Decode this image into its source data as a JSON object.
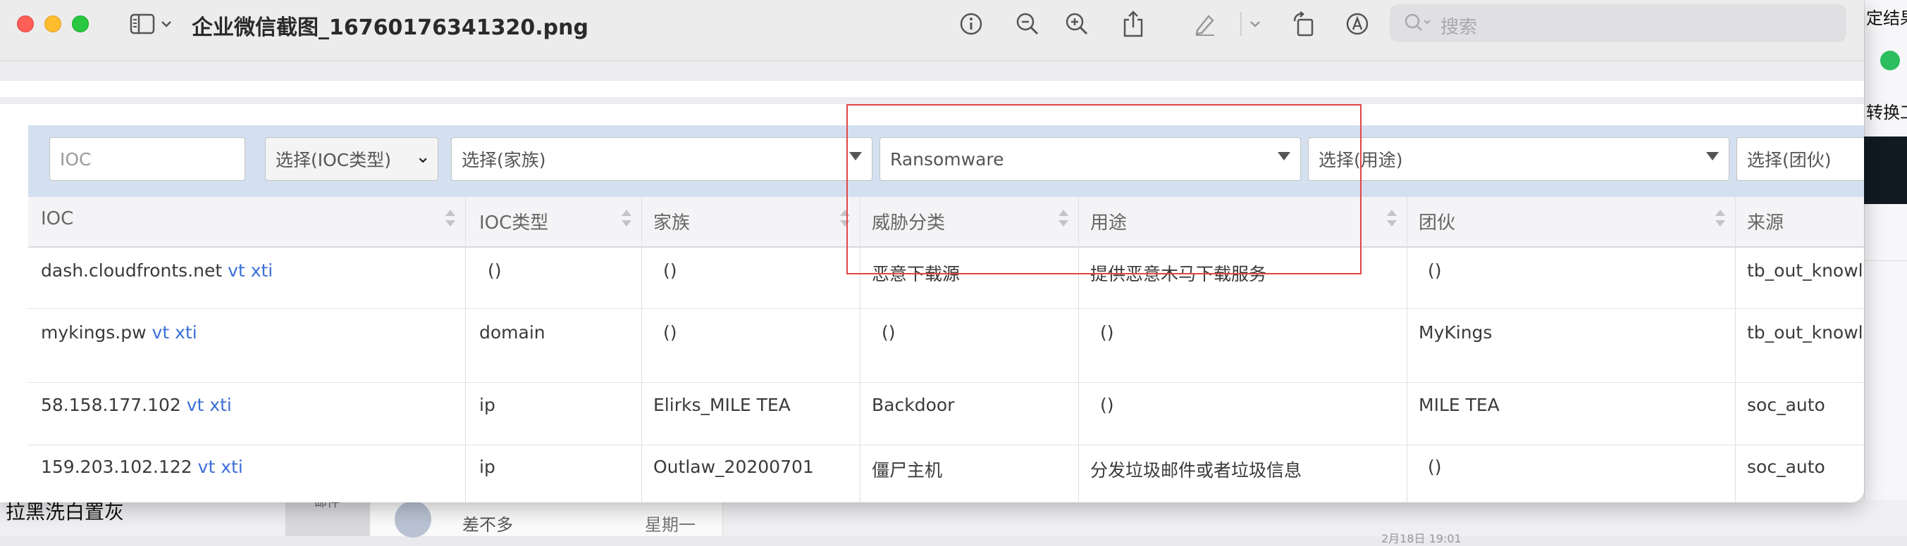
{
  "window": {
    "title": "企业微信截图_16760176341320.png",
    "search_placeholder": "搜索"
  },
  "toolbar_icons": [
    "sidebar-icon",
    "chevron-down-icon",
    "info-icon",
    "zoom-out-icon",
    "zoom-in-icon",
    "share-icon",
    "markup-pen-icon",
    "chevron-down-icon",
    "rotate-icon",
    "annotate-icon",
    "search-icon"
  ],
  "filters": {
    "ioc_placeholder": "IOC",
    "ioc_type": "选择(IOC类型)",
    "family": "选择(家族)",
    "threat_category": "Ransomware",
    "usage": "选择(用途)",
    "gang": "选择(团伙)"
  },
  "table": {
    "headers": [
      "IOC",
      "IOC类型",
      "家族",
      "威胁分类",
      "用途",
      "团伙",
      "来源"
    ],
    "rows": [
      {
        "ioc": "dash.cloudfronts.net",
        "vt": "vt",
        "xti": "xti",
        "type": "()",
        "family": "()",
        "threat": "恶意下载源",
        "usage": "提供恶意木马下载服务",
        "gang": "()",
        "source": "tb_out_knowle"
      },
      {
        "ioc": "mykings.pw",
        "vt": "vt",
        "xti": "xti",
        "type": "domain",
        "family": "()",
        "threat": "()",
        "usage": "()",
        "gang": "MyKings",
        "source": "tb_out_knowle"
      },
      {
        "ioc": "58.158.177.102",
        "vt": "vt",
        "xti": "xti",
        "type": "ip",
        "family": "Elirks_MILE TEA",
        "threat": "Backdoor",
        "usage": "()",
        "gang": "MILE TEA",
        "source": "soc_auto"
      },
      {
        "ioc": "159.203.102.122",
        "vt": "vt",
        "xti": "xti",
        "type": "ip",
        "family": "Outlaw_20200701",
        "threat": "僵尸主机",
        "usage": "分发垃圾邮件或者垃圾信息",
        "gang": "()",
        "source": "soc_auto"
      }
    ]
  },
  "background": {
    "right_text_top": "定结果",
    "right_text_mid": "转换工",
    "bottom_left_text": "拉黑洗白置灰",
    "sidebar_label": "邮件",
    "list_name": "差不多",
    "list_day": "星期一",
    "list_date": "2月18日 19:01"
  },
  "colors": {
    "filter_bar": "#d4e0f0",
    "link": "#3b6fd8",
    "highlight_box": "#e24545"
  }
}
